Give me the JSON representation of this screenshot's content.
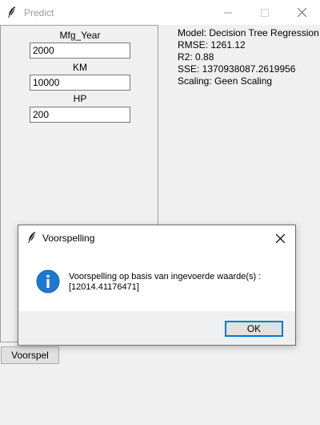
{
  "window": {
    "title": "Predict",
    "icon": "feather-icon"
  },
  "form": {
    "fields": [
      {
        "label": "Mfg_Year",
        "value": "2000"
      },
      {
        "label": "KM",
        "value": "10000"
      },
      {
        "label": "HP",
        "value": "200"
      }
    ],
    "predict_label": "Voorspel"
  },
  "info": {
    "model": "Model: Decision Tree Regression",
    "rmse": "RMSE: 1261.12",
    "r2": "R2: 0.88",
    "sse": "SSE: 1370938087.2619956",
    "scaling": "Scaling: Geen Scaling"
  },
  "dialog": {
    "title": "Voorspelling",
    "icon": "info-icon",
    "message_line1": "Voorspelling op basis van ingevoerde waarde(s) :",
    "message_line2": "[12014.41176471]",
    "ok_label": "OK"
  },
  "colors": {
    "accent": "#0078d7",
    "background": "#f0f0f0"
  }
}
